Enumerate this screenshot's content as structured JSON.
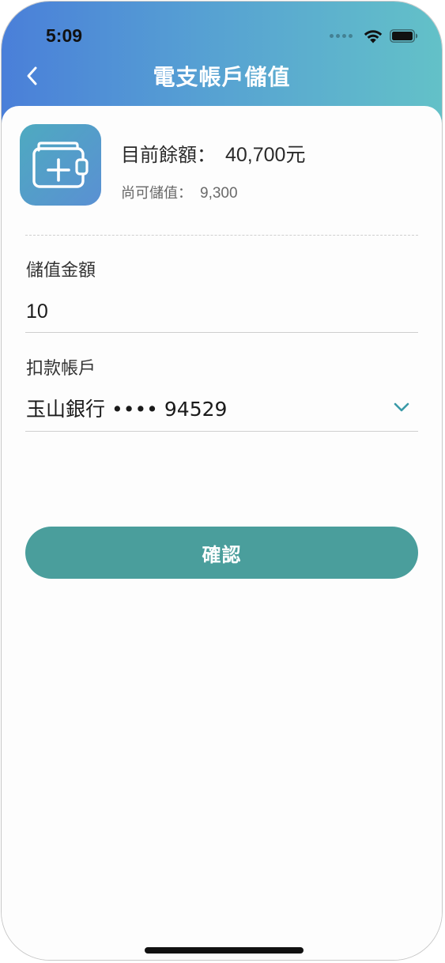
{
  "status_bar": {
    "time": "5:09"
  },
  "nav": {
    "title": "電支帳戶儲值",
    "back_icon": "chevron-left-icon"
  },
  "summary": {
    "icon": "wallet-add-icon",
    "balance_label": "目前餘額：",
    "balance_value": "40,700元",
    "available_label": "尚可儲值：",
    "available_value": "9,300"
  },
  "form": {
    "amount_label": "儲值金額",
    "amount_value": "10",
    "account_label": "扣款帳戶",
    "account_value": "玉山銀行 •••• 94529",
    "account_icon": "chevron-down-icon"
  },
  "actions": {
    "confirm_label": "確認"
  },
  "colors": {
    "header_gradient_start": "#4a7fd9",
    "header_gradient_end": "#63c1c8",
    "button": "#4a9e9c",
    "accent": "#3a9aa8"
  }
}
